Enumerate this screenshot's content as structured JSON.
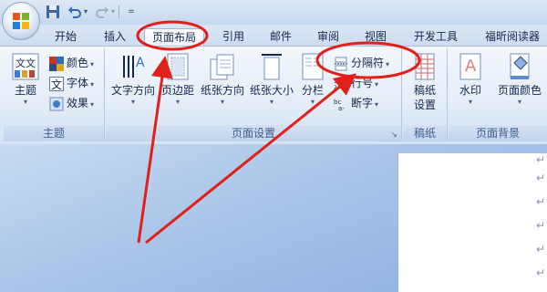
{
  "quick_access": {
    "save_icon": "save-icon",
    "undo_icon": "undo-icon",
    "redo_icon": "redo-icon",
    "customize_glyph": "="
  },
  "tabs": [
    {
      "label": "开始"
    },
    {
      "label": "插入"
    },
    {
      "label": "页面布局",
      "active": true
    },
    {
      "label": "引用"
    },
    {
      "label": "邮件"
    },
    {
      "label": "审阅"
    },
    {
      "label": "视图"
    },
    {
      "label": "开发工具"
    },
    {
      "label": "福昕阅读器"
    }
  ],
  "ribbon": {
    "theme_group": {
      "label": "主题",
      "theme_button": "主题",
      "colors": "颜色",
      "fonts": "字体",
      "effects": "效果",
      "theme_icon_text": "文文"
    },
    "page_setup_group": {
      "label": "页面设置",
      "text_direction": "文字方向",
      "margins": "页边距",
      "orientation": "纸张方向",
      "size": "纸张大小",
      "columns": "分栏",
      "breaks": "分隔符",
      "line_numbers": "行号",
      "hyphenation": "断字"
    },
    "draft_group": {
      "label": "稿纸",
      "draft_settings": "稿纸\n设置",
      "draft_line1": "稿纸",
      "draft_line2": "设置"
    },
    "background_group": {
      "label": "页面背景",
      "watermark": "水印",
      "page_color": "页面颜色",
      "watermark_icon_text": "A"
    }
  },
  "document": {
    "para_mark": "↵"
  },
  "colors": {
    "annotation_red": "#e0201a",
    "ribbon_bg": "#e3ecf7",
    "accent_blue": "#2c4f86"
  }
}
